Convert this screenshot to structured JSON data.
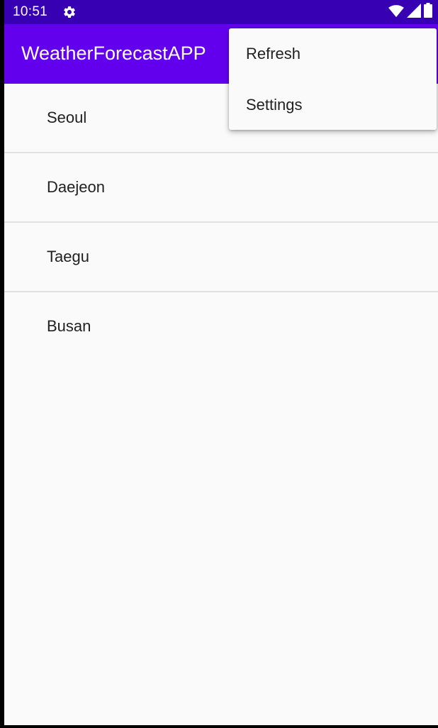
{
  "status_bar": {
    "time": "10:51",
    "left_icon": "gear-icon",
    "right_icons": [
      "wifi-icon",
      "signal-icon",
      "battery-icon"
    ]
  },
  "app_bar": {
    "title": "WeatherForecastAPP"
  },
  "cities": [
    {
      "label": "Seoul"
    },
    {
      "label": "Daejeon"
    },
    {
      "label": "Taegu"
    },
    {
      "label": "Busan"
    }
  ],
  "overflow_menu": {
    "items": [
      {
        "label": "Refresh"
      },
      {
        "label": "Settings"
      }
    ]
  },
  "colors": {
    "status_bar": "#3700b3",
    "app_bar": "#6200ee",
    "background": "#fafafa",
    "divider": "#e0e0e0",
    "text": "#212121"
  }
}
